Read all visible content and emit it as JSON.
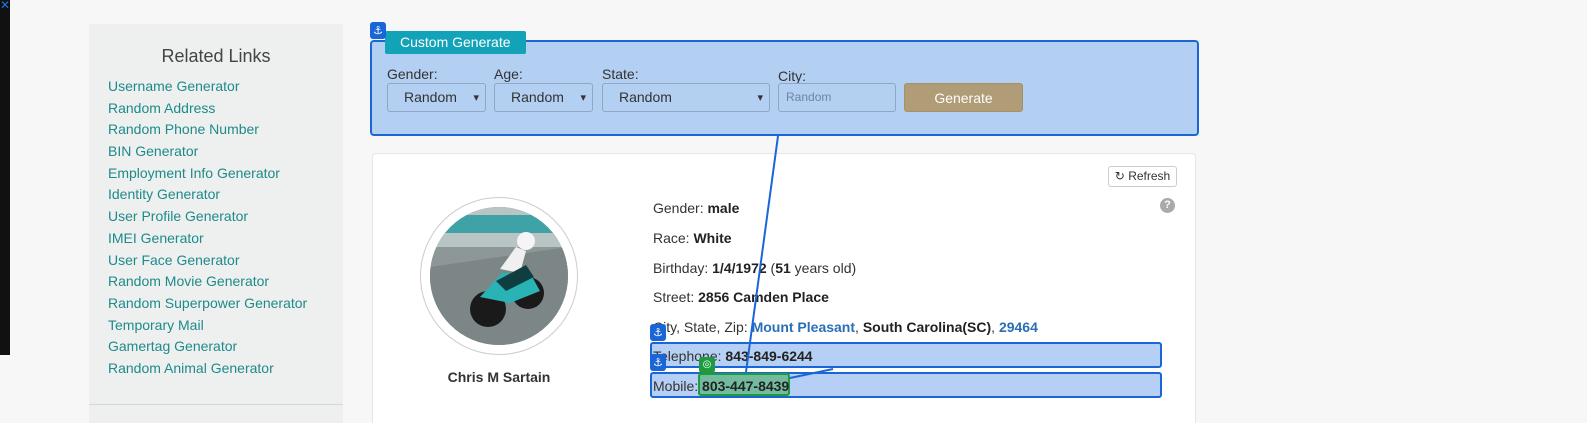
{
  "sidebar": {
    "title": "Related Links",
    "links": [
      "Username Generator",
      "Random Address",
      "Random Phone Number",
      "BIN Generator",
      "Employment Info Generator",
      "Identity Generator",
      "User Profile Generator",
      "IMEI Generator",
      "User Face Generator",
      "Random Movie Generator",
      "Random Superpower Generator",
      "Temporary Mail",
      "Gamertag Generator",
      "Random Animal Generator"
    ]
  },
  "generator": {
    "tab_label": "Custom Generate",
    "gender_label": "Gender:",
    "gender_value": "Random",
    "age_label": "Age:",
    "age_value": "Random",
    "state_label": "State:",
    "state_value": "Random",
    "city_label": "City:",
    "city_placeholder": "Random",
    "generate_label": "Generate"
  },
  "profile": {
    "refresh_label": "Refresh",
    "name": "Chris M Sartain",
    "gender_label": "Gender:",
    "gender": "male",
    "race_label": "Race:",
    "race": "White",
    "birthday_label": "Birthday:",
    "birthday": "1/4/1972",
    "age": "51",
    "age_suffix": "years old)",
    "street_label": "Street:",
    "street": "2856 Camden Place",
    "csz_label": "City, State, Zip:",
    "city": "Mount Pleasant",
    "state": "South Carolina(SC)",
    "zip": "29464",
    "telephone_label": "Telephone:",
    "telephone": "843-849-6244",
    "mobile_label": "Mobile:",
    "mobile": "803-447-8439"
  },
  "icons": {
    "anchor": "anchor-icon",
    "refresh": "refresh-icon",
    "help": "help-icon",
    "target": "target-icon",
    "chevron": "chevron-down-icon"
  },
  "colors": {
    "link": "#1f8a8a",
    "highlight_blue": "#1a66d6",
    "highlight_green": "#1f9a3e",
    "generate_button": "#b09c76",
    "tab": "#13a3b8"
  }
}
